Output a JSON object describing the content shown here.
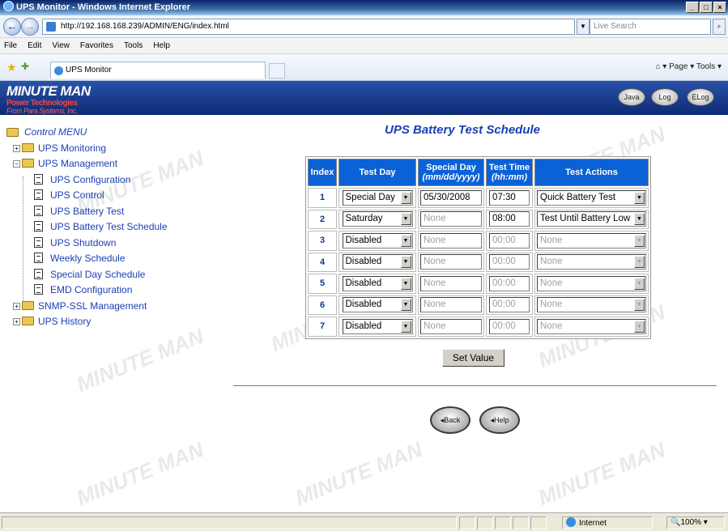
{
  "window": {
    "title": "UPS Monitor - Windows Internet Explorer"
  },
  "browser": {
    "url": "http://192.168.168.239/ADMIN/ENG/index.html",
    "search_placeholder": "Live Search",
    "menu": [
      "File",
      "Edit",
      "View",
      "Favorites",
      "Tools",
      "Help"
    ],
    "tab_title": "UPS Monitor",
    "commands": "Page ▾  Tools ▾"
  },
  "banner": {
    "logo": "MINUTE MAN",
    "logo_sub": "Power Technologies",
    "logo_sub2": "From Para Systems, Inc.",
    "buttons": [
      "Java",
      "Log",
      "ELog"
    ]
  },
  "tree": {
    "root": "Control MENU",
    "ups_monitoring": "UPS Monitoring",
    "ups_management": "UPS Management",
    "children": [
      "UPS Configuration",
      "UPS Control",
      "UPS Battery Test",
      "UPS Battery Test Schedule",
      "UPS Shutdown",
      "Weekly Schedule",
      "Special Day Schedule",
      "EMD Configuration"
    ],
    "snmp": "SNMP-SSL Management",
    "history": "UPS History"
  },
  "page": {
    "title": "UPS Battery Test Schedule",
    "headers": {
      "index": "Index",
      "test_day": "Test Day",
      "special_day": "Special Day",
      "special_day_fmt": "(mm/dd/yyyy)",
      "test_time": "Test Time",
      "test_time_fmt": "(hh:mm)",
      "actions": "Test Actions"
    },
    "rows": [
      {
        "index": "1",
        "day": "Special Day",
        "date": "05/30/2008",
        "time": "07:30",
        "action": "Quick Battery Test"
      },
      {
        "index": "2",
        "day": "Saturday",
        "date": "None",
        "time": "08:00",
        "action": "Test Until Battery Low"
      },
      {
        "index": "3",
        "day": "Disabled",
        "date": "None",
        "time": "00:00",
        "action": "None"
      },
      {
        "index": "4",
        "day": "Disabled",
        "date": "None",
        "time": "00:00",
        "action": "None"
      },
      {
        "index": "5",
        "day": "Disabled",
        "date": "None",
        "time": "00:00",
        "action": "None"
      },
      {
        "index": "6",
        "day": "Disabled",
        "date": "None",
        "time": "00:00",
        "action": "None"
      },
      {
        "index": "7",
        "day": "Disabled",
        "date": "None",
        "time": "00:00",
        "action": "None"
      }
    ],
    "set_value": "Set Value",
    "back": "Back",
    "help": "Help"
  },
  "status": {
    "zone": "Internet",
    "zoom": "100%"
  }
}
